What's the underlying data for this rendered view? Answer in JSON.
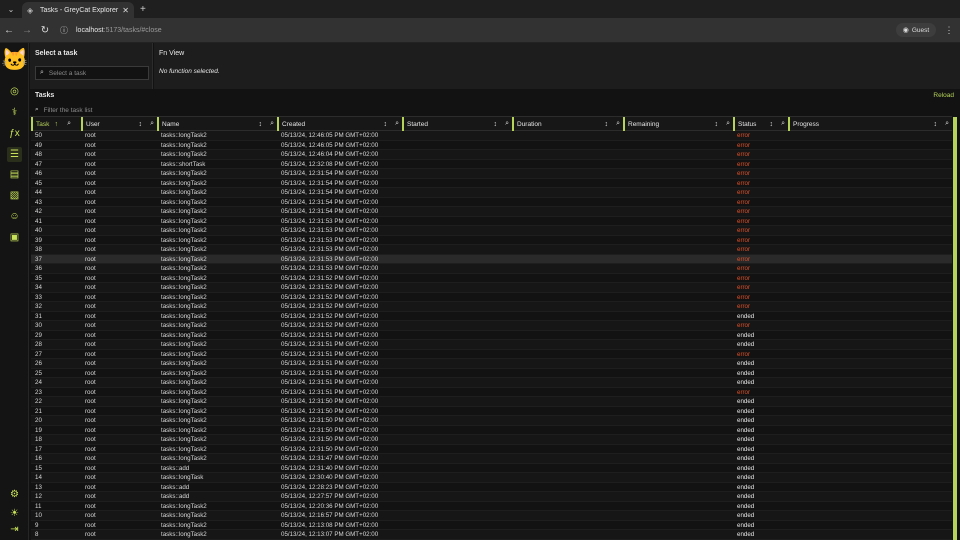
{
  "browser": {
    "tab_title": "Tasks - GreyCat Explorer",
    "url_host": "localhost",
    "url_path": ":5173/tasks/#close",
    "profile": "Guest"
  },
  "panel_left": {
    "title": "Select a task",
    "search_placeholder": "Select a task"
  },
  "panel_right": {
    "title": "Fn View",
    "empty_text": "No function selected."
  },
  "tasks": {
    "title": "Tasks",
    "reload_label": "Reload",
    "filter_placeholder": "Filter the task list",
    "columns": [
      "Task",
      "User",
      "Name",
      "Created",
      "Started",
      "Duration",
      "Remaining",
      "Status",
      "Progress"
    ],
    "rows": [
      [
        "50",
        "root",
        "tasks::longTask2",
        "05/13/24, 12:46:05 PM GMT+02:00",
        "error"
      ],
      [
        "49",
        "root",
        "tasks::longTask2",
        "05/13/24, 12:46:05 PM GMT+02:00",
        "error"
      ],
      [
        "48",
        "root",
        "tasks::longTask2",
        "05/13/24, 12:46:04 PM GMT+02:00",
        "error"
      ],
      [
        "47",
        "root",
        "tasks::shortTask",
        "05/13/24, 12:32:08 PM GMT+02:00",
        "error"
      ],
      [
        "46",
        "root",
        "tasks::longTask2",
        "05/13/24, 12:31:54 PM GMT+02:00",
        "error"
      ],
      [
        "45",
        "root",
        "tasks::longTask2",
        "05/13/24, 12:31:54 PM GMT+02:00",
        "error"
      ],
      [
        "44",
        "root",
        "tasks::longTask2",
        "05/13/24, 12:31:54 PM GMT+02:00",
        "error"
      ],
      [
        "43",
        "root",
        "tasks::longTask2",
        "05/13/24, 12:31:54 PM GMT+02:00",
        "error"
      ],
      [
        "42",
        "root",
        "tasks::longTask2",
        "05/13/24, 12:31:54 PM GMT+02:00",
        "error"
      ],
      [
        "41",
        "root",
        "tasks::longTask2",
        "05/13/24, 12:31:53 PM GMT+02:00",
        "error"
      ],
      [
        "40",
        "root",
        "tasks::longTask2",
        "05/13/24, 12:31:53 PM GMT+02:00",
        "error"
      ],
      [
        "39",
        "root",
        "tasks::longTask2",
        "05/13/24, 12:31:53 PM GMT+02:00",
        "error"
      ],
      [
        "38",
        "root",
        "tasks::longTask2",
        "05/13/24, 12:31:53 PM GMT+02:00",
        "error"
      ],
      [
        "37",
        "root",
        "tasks::longTask2",
        "05/13/24, 12:31:53 PM GMT+02:00",
        "error"
      ],
      [
        "36",
        "root",
        "tasks::longTask2",
        "05/13/24, 12:31:53 PM GMT+02:00",
        "error"
      ],
      [
        "35",
        "root",
        "tasks::longTask2",
        "05/13/24, 12:31:52 PM GMT+02:00",
        "error"
      ],
      [
        "34",
        "root",
        "tasks::longTask2",
        "05/13/24, 12:31:52 PM GMT+02:00",
        "error"
      ],
      [
        "33",
        "root",
        "tasks::longTask2",
        "05/13/24, 12:31:52 PM GMT+02:00",
        "error"
      ],
      [
        "32",
        "root",
        "tasks::longTask2",
        "05/13/24, 12:31:52 PM GMT+02:00",
        "error"
      ],
      [
        "31",
        "root",
        "tasks::longTask2",
        "05/13/24, 12:31:52 PM GMT+02:00",
        "ended"
      ],
      [
        "30",
        "root",
        "tasks::longTask2",
        "05/13/24, 12:31:52 PM GMT+02:00",
        "error"
      ],
      [
        "29",
        "root",
        "tasks::longTask2",
        "05/13/24, 12:31:51 PM GMT+02:00",
        "ended"
      ],
      [
        "28",
        "root",
        "tasks::longTask2",
        "05/13/24, 12:31:51 PM GMT+02:00",
        "ended"
      ],
      [
        "27",
        "root",
        "tasks::longTask2",
        "05/13/24, 12:31:51 PM GMT+02:00",
        "error"
      ],
      [
        "26",
        "root",
        "tasks::longTask2",
        "05/13/24, 12:31:51 PM GMT+02:00",
        "ended"
      ],
      [
        "25",
        "root",
        "tasks::longTask2",
        "05/13/24, 12:31:51 PM GMT+02:00",
        "ended"
      ],
      [
        "24",
        "root",
        "tasks::longTask2",
        "05/13/24, 12:31:51 PM GMT+02:00",
        "ended"
      ],
      [
        "23",
        "root",
        "tasks::longTask2",
        "05/13/24, 12:31:51 PM GMT+02:00",
        "error"
      ],
      [
        "22",
        "root",
        "tasks::longTask2",
        "05/13/24, 12:31:50 PM GMT+02:00",
        "ended"
      ],
      [
        "21",
        "root",
        "tasks::longTask2",
        "05/13/24, 12:31:50 PM GMT+02:00",
        "ended"
      ],
      [
        "20",
        "root",
        "tasks::longTask2",
        "05/13/24, 12:31:50 PM GMT+02:00",
        "ended"
      ],
      [
        "19",
        "root",
        "tasks::longTask2",
        "05/13/24, 12:31:50 PM GMT+02:00",
        "ended"
      ],
      [
        "18",
        "root",
        "tasks::longTask2",
        "05/13/24, 12:31:50 PM GMT+02:00",
        "ended"
      ],
      [
        "17",
        "root",
        "tasks::longTask2",
        "05/13/24, 12:31:50 PM GMT+02:00",
        "ended"
      ],
      [
        "16",
        "root",
        "tasks::longTask2",
        "05/13/24, 12:31:47 PM GMT+02:00",
        "ended"
      ],
      [
        "15",
        "root",
        "tasks::add",
        "05/13/24, 12:31:40 PM GMT+02:00",
        "ended"
      ],
      [
        "14",
        "root",
        "tasks::longTask",
        "05/13/24, 12:30:40 PM GMT+02:00",
        "ended"
      ],
      [
        "13",
        "root",
        "tasks::add",
        "05/13/24, 12:28:23 PM GMT+02:00",
        "ended"
      ],
      [
        "12",
        "root",
        "tasks::add",
        "05/13/24, 12:27:57 PM GMT+02:00",
        "ended"
      ],
      [
        "11",
        "root",
        "tasks::longTask2",
        "05/13/24, 12:20:36 PM GMT+02:00",
        "ended"
      ],
      [
        "10",
        "root",
        "tasks::longTask2",
        "05/13/24, 12:16:57 PM GMT+02:00",
        "ended"
      ],
      [
        "9",
        "root",
        "tasks::longTask2",
        "05/13/24, 12:13:08 PM GMT+02:00",
        "ended"
      ],
      [
        "8",
        "root",
        "tasks::longTask2",
        "05/13/24, 12:13:07 PM GMT+02:00",
        "ended"
      ]
    ]
  },
  "colors": {
    "accent": "#b6d35a",
    "error": "#e0502a"
  }
}
